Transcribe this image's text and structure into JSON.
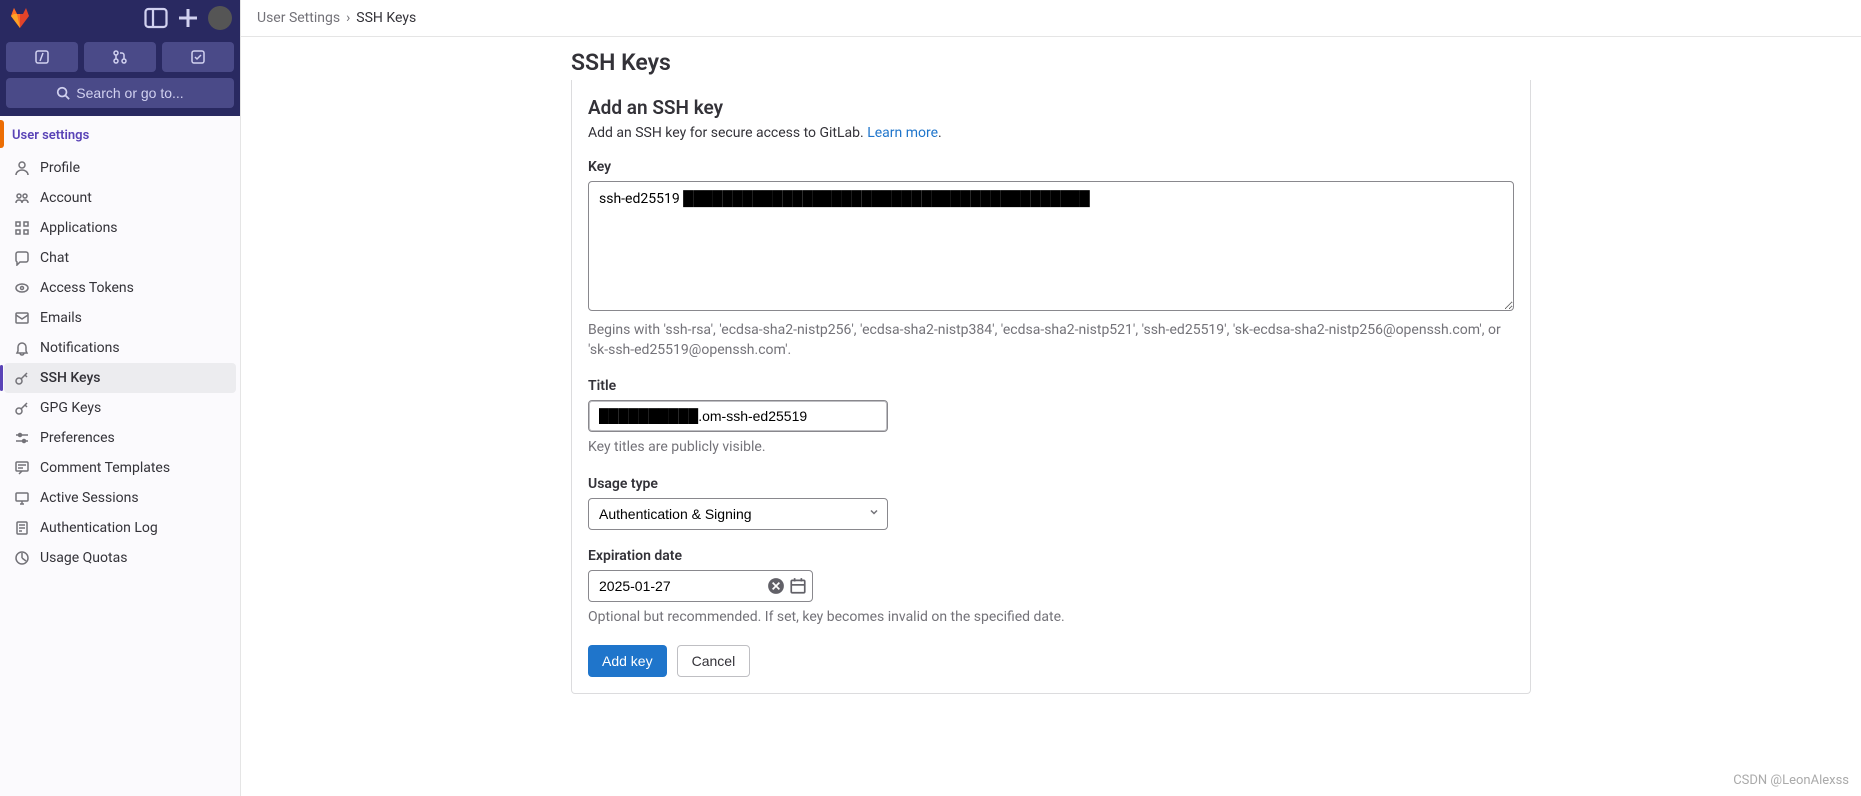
{
  "topbar": {
    "search_label": "Search or go to..."
  },
  "sidebar": {
    "section_title": "User settings",
    "items": [
      {
        "label": "Profile",
        "icon": "user-icon"
      },
      {
        "label": "Account",
        "icon": "account-icon"
      },
      {
        "label": "Applications",
        "icon": "applications-icon"
      },
      {
        "label": "Chat",
        "icon": "chat-icon"
      },
      {
        "label": "Access Tokens",
        "icon": "token-icon"
      },
      {
        "label": "Emails",
        "icon": "email-icon"
      },
      {
        "label": "Notifications",
        "icon": "bell-icon"
      },
      {
        "label": "SSH Keys",
        "icon": "key-icon",
        "active": true
      },
      {
        "label": "GPG Keys",
        "icon": "key-icon"
      },
      {
        "label": "Preferences",
        "icon": "preferences-icon"
      },
      {
        "label": "Comment Templates",
        "icon": "comment-icon"
      },
      {
        "label": "Active Sessions",
        "icon": "sessions-icon"
      },
      {
        "label": "Authentication Log",
        "icon": "log-icon"
      },
      {
        "label": "Usage Quotas",
        "icon": "quota-icon"
      }
    ]
  },
  "breadcrumb": {
    "parent": "User Settings",
    "current": "SSH Keys"
  },
  "page": {
    "title": "SSH Keys"
  },
  "form": {
    "panel_title": "Add an SSH key",
    "panel_desc_pre": "Add an SSH key for secure access to GitLab. ",
    "learn_more": "Learn more",
    "key_label": "Key",
    "key_value": "ssh-ed25519 █████████████████████████████████████████",
    "key_help": "Begins with 'ssh-rsa', 'ecdsa-sha2-nistp256', 'ecdsa-sha2-nistp384', 'ecdsa-sha2-nistp521', 'ssh-ed25519', 'sk-ecdsa-sha2-nistp256@openssh.com', or 'sk-ssh-ed25519@openssh.com'.",
    "title_label": "Title",
    "title_value": "██████████.om-ssh-ed25519",
    "title_help": "Key titles are publicly visible.",
    "usage_label": "Usage type",
    "usage_value": "Authentication & Signing",
    "expire_label": "Expiration date",
    "expire_value": "2025-01-27",
    "expire_help": "Optional but recommended. If set, key becomes invalid on the specified date.",
    "add_btn": "Add key",
    "cancel_btn": "Cancel"
  },
  "watermark": "CSDN @LeonAlexss"
}
